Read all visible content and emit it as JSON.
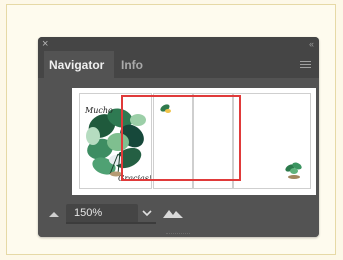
{
  "panel": {
    "close_glyph": "×",
    "collapse_glyph": "‹‹",
    "tabs": [
      {
        "label": "Navigator",
        "active": true
      },
      {
        "label": "Info",
        "active": false
      }
    ],
    "menu_icon": "hamburger-menu-icon"
  },
  "preview": {
    "card_text_top": "Mucho",
    "card_text_bottom": "Gracias!",
    "artboard_count": 4,
    "view_color": "#e03a3a"
  },
  "zoom": {
    "value": "150%"
  },
  "colors": {
    "panel_bg": "#535353",
    "header_bg": "#454545",
    "accent_red": "#e03a3a"
  }
}
